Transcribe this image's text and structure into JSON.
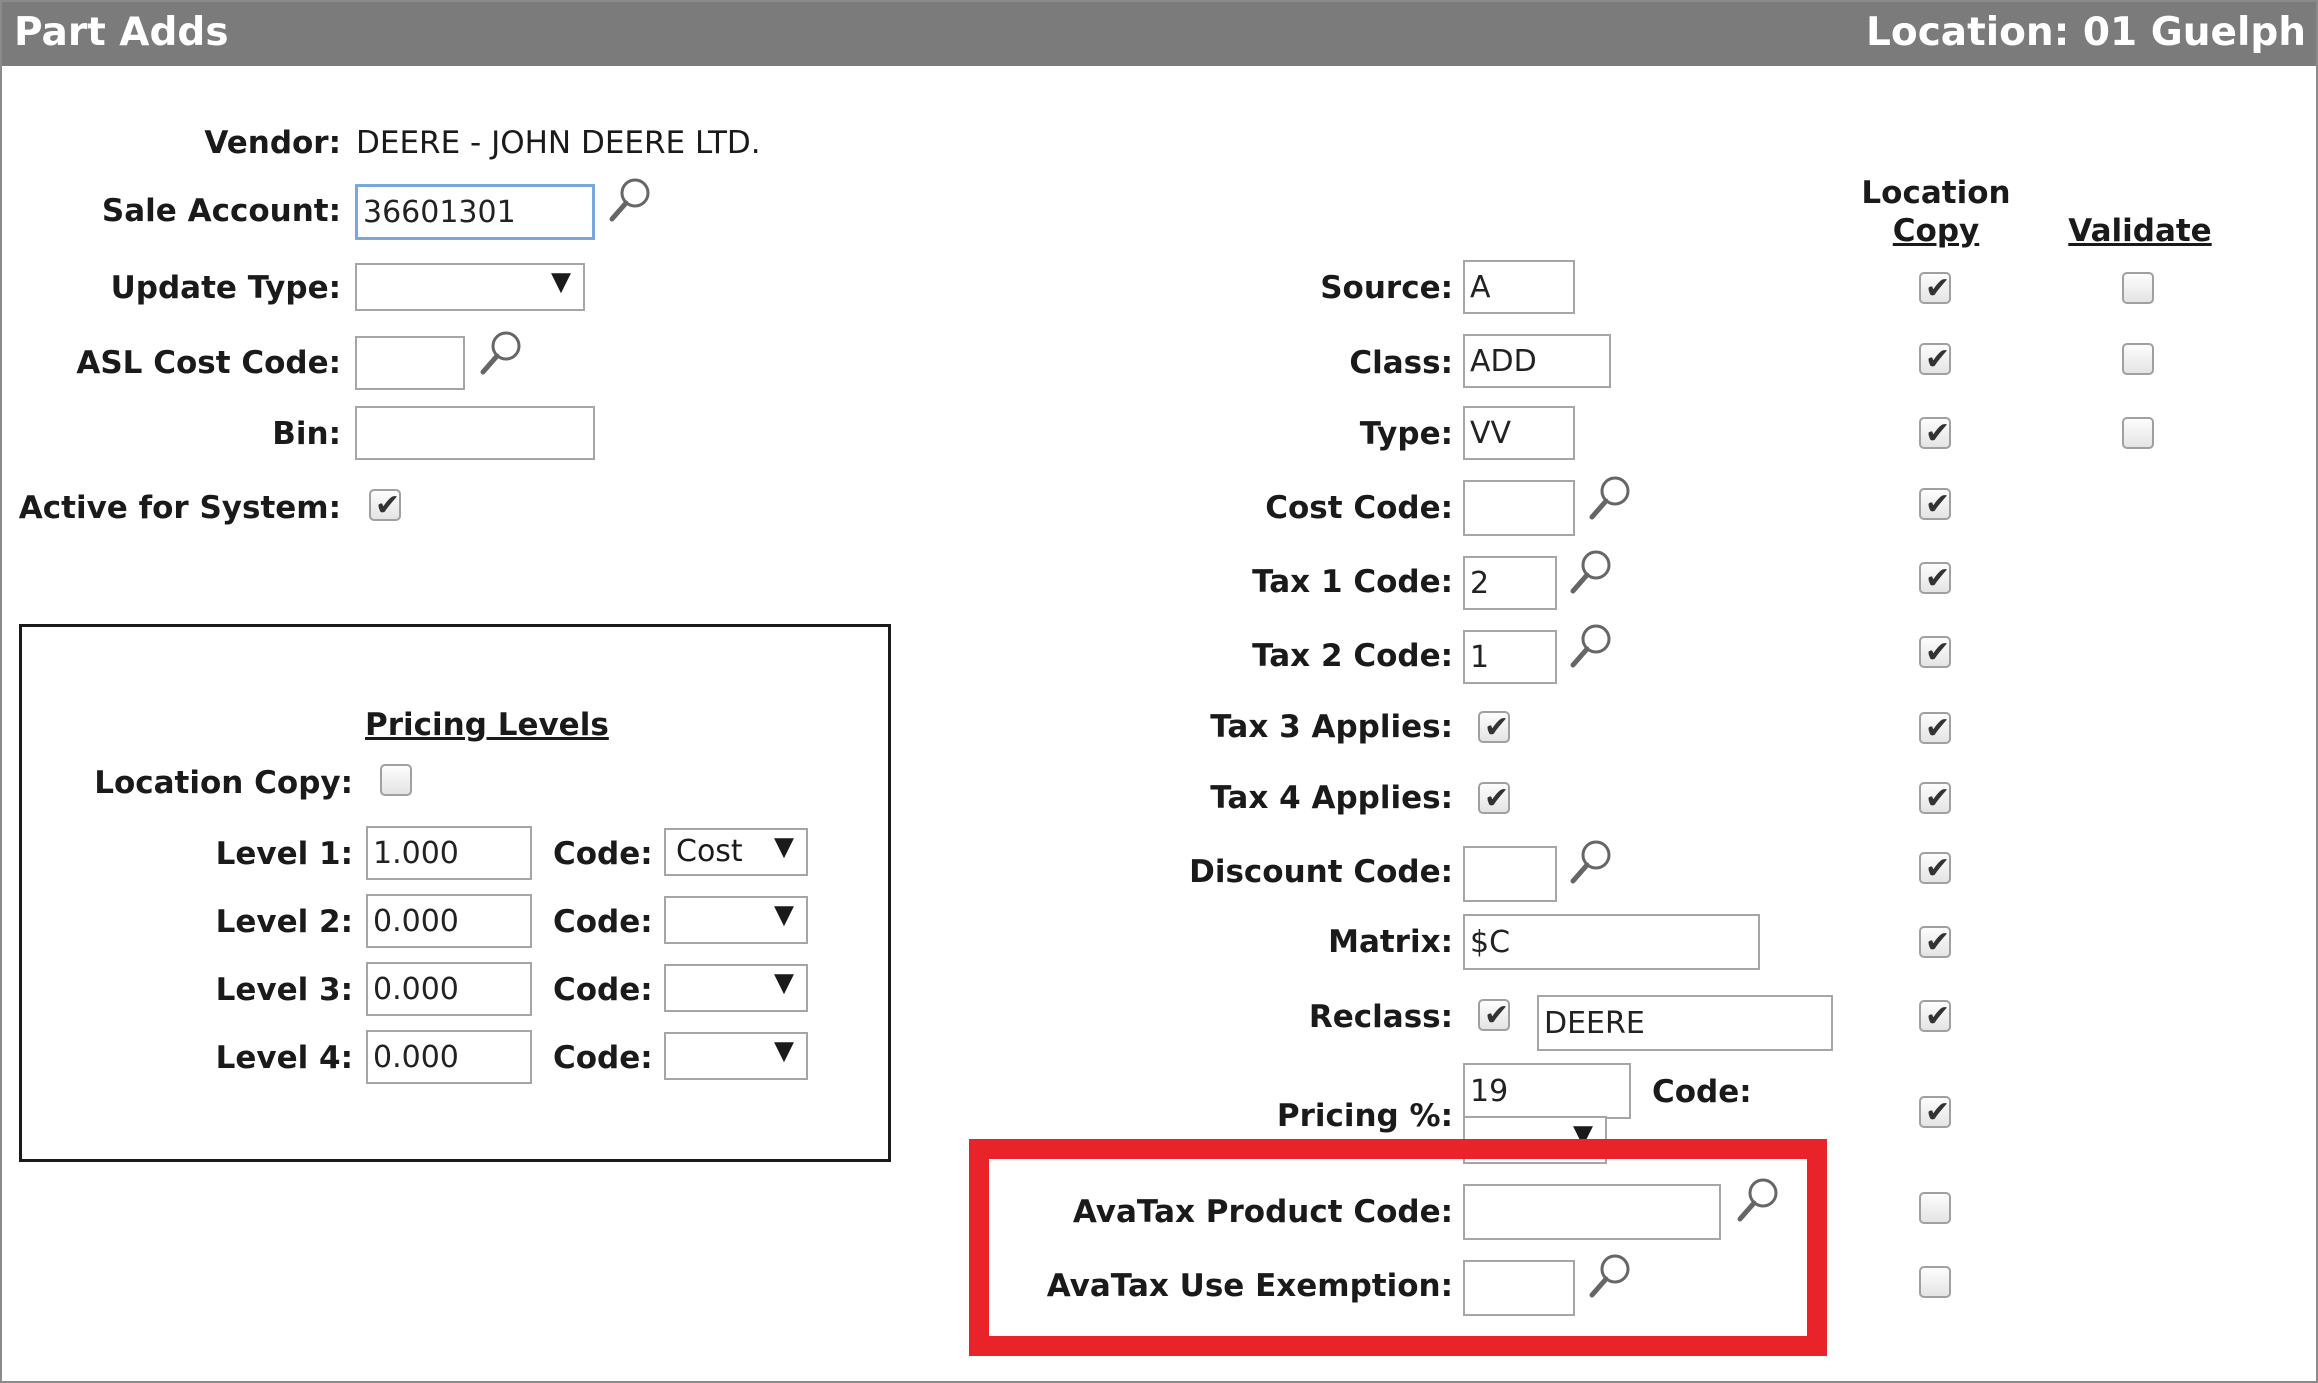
{
  "title": "Part Adds",
  "location": "Location:  01 Guelph",
  "left": {
    "vendor_label": "Vendor:",
    "vendor_value": "DEERE - JOHN DEERE LTD.",
    "sale_account_label": "Sale Account:",
    "sale_account_value": "36601301",
    "update_type_label": "Update Type:",
    "update_type_value": "",
    "asl_cost_code_label": "ASL Cost Code:",
    "asl_cost_code_value": "",
    "bin_label": "Bin:",
    "bin_value": "",
    "active_label": "Active for System:",
    "active_checked": true
  },
  "pricing": {
    "heading": "Pricing Levels",
    "location_copy_label": "Location Copy:",
    "location_copy_checked": false,
    "code_label": "Code:",
    "levels": [
      {
        "label": "Level 1:",
        "value": "1.000",
        "code": "Cost"
      },
      {
        "label": "Level 2:",
        "value": "0.000",
        "code": ""
      },
      {
        "label": "Level 3:",
        "value": "0.000",
        "code": ""
      },
      {
        "label": "Level 4:",
        "value": "0.000",
        "code": ""
      }
    ]
  },
  "columns": {
    "location_copy_line1": "Location",
    "location_copy_line2": "Copy",
    "validate": "Validate"
  },
  "right": {
    "source_label": "Source:",
    "source_value": "A",
    "class_label": "Class:",
    "class_value": "ADD",
    "type_label": "Type:",
    "type_value": "VV",
    "cost_code_label": "Cost Code:",
    "cost_code_value": "",
    "tax1_label": "Tax 1 Code:",
    "tax1_value": "2",
    "tax2_label": "Tax 2 Code:",
    "tax2_value": "1",
    "tax3_label": "Tax 3 Applies:",
    "tax3_checked": true,
    "tax4_label": "Tax 4 Applies:",
    "tax4_checked": true,
    "discount_label": "Discount Code:",
    "discount_value": "",
    "matrix_label": "Matrix:",
    "matrix_value": "$C",
    "reclass_label": "Reclass:",
    "reclass_checked": true,
    "reclass_value": "DEERE",
    "pricing_pct_label": "Pricing %:",
    "pricing_pct_value": "19",
    "pricing_code_label": "Code:",
    "avatax_product_label": "AvaTax Product Code:",
    "avatax_product_value": "",
    "avatax_use_label": "AvaTax Use Exemption:",
    "avatax_use_value": ""
  },
  "location_copy_checks": [
    true,
    true,
    true,
    true,
    true,
    true,
    true,
    true,
    true,
    true,
    true,
    true,
    false,
    false
  ],
  "validate_checks": [
    false,
    false,
    false
  ],
  "colors": {
    "titlebar": "#7b7b7b",
    "highlight": "#e8232a"
  }
}
